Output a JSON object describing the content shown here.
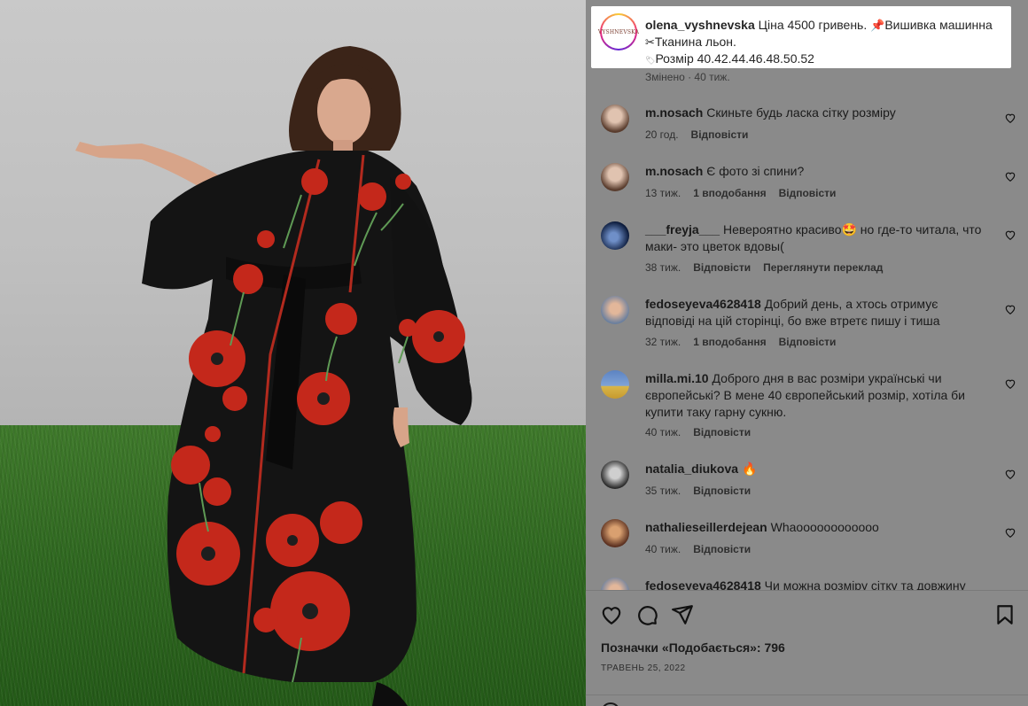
{
  "post": {
    "username": "olena_vyshnevska",
    "avatar_text": "VYSHNEVSKA",
    "caption_line1": "Ціна 4500 гривень. ",
    "caption_line1b": "Вишивка машинна",
    "caption_line2": "Тканина льон.",
    "caption_line3": "Розмір 40.42.44.46.48.50.52",
    "edited": "Змінено · 40 тиж."
  },
  "comments": [
    {
      "user": "m.nosach",
      "text": "Скиньте будь ласка сітку розміру",
      "time": "20 год.",
      "likes": "",
      "reply": "Відповісти",
      "extra": ""
    },
    {
      "user": "m.nosach",
      "text": "Є фото зі спини?",
      "time": "13 тиж.",
      "likes": "1 вподобання",
      "reply": "Відповісти",
      "extra": ""
    },
    {
      "user": "___freyja___",
      "text": "Невероятно красиво🤩 но где-то читала, что маки- это цветок вдовы(",
      "time": "38 тиж.",
      "likes": "",
      "reply": "Відповісти",
      "extra": "Переглянути переклад"
    },
    {
      "user": "fedoseyeva4628418",
      "text": "Добрий день, а хтось отримує відповіді на цій сторінці, бо вже втретє пишу і тиша",
      "time": "32 тиж.",
      "likes": "1 вподобання",
      "reply": "Відповісти",
      "extra": ""
    },
    {
      "user": "milla.mi.10",
      "text": "Доброго дня в вас розміри українські чи європейські? В мене 40 європейський розмір, хотіла би купити таку гарну сукню.",
      "time": "40 тиж.",
      "likes": "",
      "reply": "Відповісти",
      "extra": ""
    },
    {
      "user": "natalia_diukova",
      "text": "🔥",
      "time": "35 тиж.",
      "likes": "",
      "reply": "Відповісти",
      "extra": ""
    },
    {
      "user": "nathalieseillerdejean",
      "text": "Whaoooooooooooo",
      "time": "40 тиж.",
      "likes": "",
      "reply": "Відповісти",
      "extra": ""
    },
    {
      "user": "fedoseyeva4628418",
      "text": "Чи можна розміру сітку та довжину",
      "time": "",
      "likes": "",
      "reply": "",
      "extra": ""
    }
  ],
  "likes_text": "Позначки «Подобається»: 796",
  "date_text": "ТРАВЕНЬ 25, 2022",
  "icons": {
    "like": "heart-icon",
    "comment": "comment-bubble-icon",
    "share": "paper-plane-icon",
    "save": "bookmark-icon"
  }
}
